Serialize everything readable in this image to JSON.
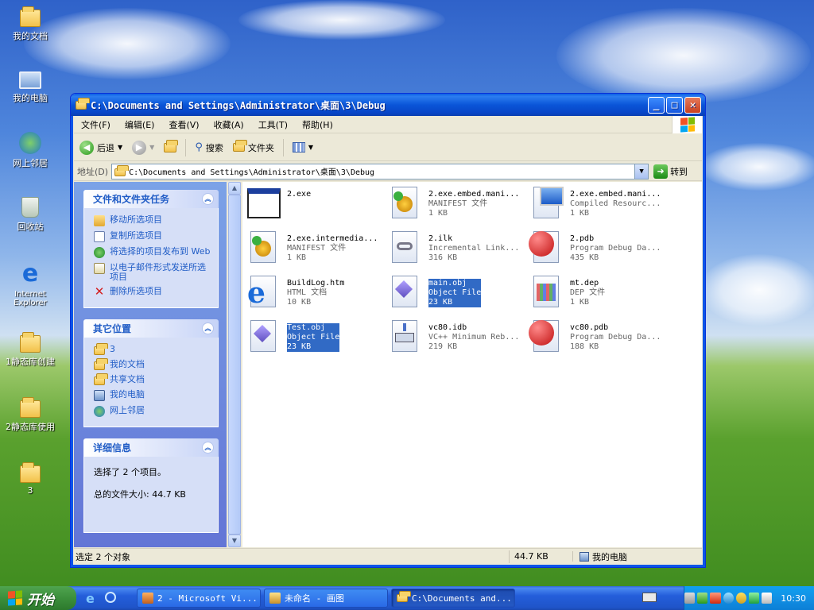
{
  "desktop": {
    "icons": [
      {
        "label": "我的文档",
        "icon": "my-documents-icon"
      },
      {
        "label": "我的电脑",
        "icon": "my-computer-icon"
      },
      {
        "label": "网上邻居",
        "icon": "network-places-icon"
      },
      {
        "label": "回收站",
        "icon": "recycle-bin-icon"
      },
      {
        "label": "Internet Explorer",
        "icon": "ie-icon"
      },
      {
        "label": "1静态库创建",
        "icon": "folder-icon"
      },
      {
        "label": "2静态库使用",
        "icon": "folder-icon"
      },
      {
        "label": "3",
        "icon": "folder-icon"
      }
    ]
  },
  "window": {
    "title": "C:\\Documents and Settings\\Administrator\\桌面\\3\\Debug",
    "menu": [
      "文件(F)",
      "编辑(E)",
      "查看(V)",
      "收藏(A)",
      "工具(T)",
      "帮助(H)"
    ],
    "toolbar": {
      "back": "后退",
      "search": "搜索",
      "folders": "文件夹"
    },
    "address": {
      "label": "地址(D)",
      "value": "C:\\Documents and Settings\\Administrator\\桌面\\3\\Debug",
      "go": "转到"
    }
  },
  "left_pane": {
    "tasks": {
      "title": "文件和文件夹任务",
      "links": [
        "移动所选项目",
        "复制所选项目",
        "将选择的项目发布到 Web",
        "以电子邮件形式发送所选项目",
        "删除所选项目"
      ]
    },
    "places": {
      "title": "其它位置",
      "links": [
        "3",
        "我的文档",
        "共享文档",
        "我的电脑",
        "网上邻居"
      ]
    },
    "details": {
      "title": "详细信息",
      "selected": "选择了 2 个项目。",
      "total": "总的文件大小: 44.7 KB"
    }
  },
  "files": [
    {
      "name": "2.exe",
      "type": "",
      "size": "",
      "icon": "exe-icon",
      "selected": false
    },
    {
      "name": "2.exe.embed.mani...",
      "type": "MANIFEST 文件",
      "size": "1 KB",
      "icon": "manifest-icon",
      "selected": false
    },
    {
      "name": "2.exe.embed.mani...",
      "type": "Compiled Resourc...",
      "size": "1 KB",
      "icon": "compiled-resource-icon",
      "selected": false
    },
    {
      "name": "2.exe.intermedia...",
      "type": "MANIFEST 文件",
      "size": "1 KB",
      "icon": "manifest-icon",
      "selected": false
    },
    {
      "name": "2.ilk",
      "type": "Incremental Link...",
      "size": "316 KB",
      "icon": "link-icon",
      "selected": false
    },
    {
      "name": "2.pdb",
      "type": "Program Debug Da...",
      "size": "435 KB",
      "icon": "pdb-icon",
      "selected": false
    },
    {
      "name": "BuildLog.htm",
      "type": "HTML 文档",
      "size": "10 KB",
      "icon": "html-icon",
      "selected": false
    },
    {
      "name": "main.obj",
      "type": "Object File",
      "size": "23 KB",
      "icon": "obj-icon",
      "selected": true
    },
    {
      "name": "mt.dep",
      "type": "DEP 文件",
      "size": "1 KB",
      "icon": "dep-icon",
      "selected": false
    },
    {
      "name": "Test.obj",
      "type": "Object File",
      "size": "23 KB",
      "icon": "obj-icon",
      "selected": true
    },
    {
      "name": "vc80.idb",
      "type": "VC++ Minimum Reb...",
      "size": "219 KB",
      "icon": "idb-icon",
      "selected": false
    },
    {
      "name": "vc80.pdb",
      "type": "Program Debug Da...",
      "size": "188 KB",
      "icon": "pdb-icon",
      "selected": false
    }
  ],
  "statusbar": {
    "objects": "选定 2 个对象",
    "size": "44.7 KB",
    "location": "我的电脑"
  },
  "taskbar": {
    "start": "开始",
    "buttons": [
      "2 - Microsoft Vi...",
      "未命名 - 画图",
      "C:\\Documents and..."
    ],
    "clock": "10:30"
  }
}
